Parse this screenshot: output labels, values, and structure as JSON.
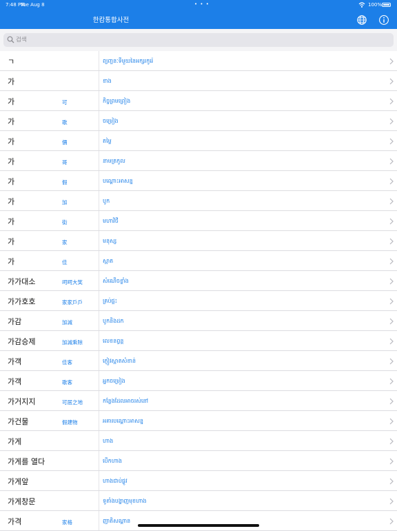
{
  "status": {
    "time": "7:48 PM",
    "date": "Tue Aug 8",
    "dots": "• • •",
    "battery": "100%"
  },
  "nav": {
    "title": "한캄통합사전",
    "icons": [
      "globe-icon",
      "info-icon"
    ]
  },
  "search": {
    "placeholder": "검색",
    "value": ""
  },
  "entries": [
    {
      "word": "ㄱ",
      "hanja": "",
      "meaning": "ព្យញ្ជនៈទីមួយនៃអក្សរកូរ៉េ"
    },
    {
      "word": "가",
      "hanja": "",
      "meaning": "ខាង"
    },
    {
      "word": "가",
      "hanja": "可",
      "meaning": "កិច្ចព្រមព្រៀង"
    },
    {
      "word": "가",
      "hanja": "歌",
      "meaning": "ចម្រៀង"
    },
    {
      "word": "가",
      "hanja": "價",
      "meaning": "តម្លៃ"
    },
    {
      "word": "가",
      "hanja": "哥",
      "meaning": "នាមត្រកូល"
    },
    {
      "word": "가",
      "hanja": "假",
      "meaning": "បណ្ដោះអាសន្ន"
    },
    {
      "word": "가",
      "hanja": "加",
      "meaning": "បូក"
    },
    {
      "word": "가",
      "hanja": "街",
      "meaning": "មហាវិថី"
    },
    {
      "word": "가",
      "hanja": "家",
      "meaning": "មនុស្ស"
    },
    {
      "word": "가",
      "hanja": "佳",
      "meaning": "ស្អាត"
    },
    {
      "word": "가가대소",
      "hanja": "呵呵大笑",
      "meaning": "សំណើចខ្លាំង"
    },
    {
      "word": "가가호호",
      "hanja": "家家戶戶",
      "meaning": "គ្រប់ផ្ទះ"
    },
    {
      "word": "가감",
      "hanja": "加減",
      "meaning": "បូកនិងដក"
    },
    {
      "word": "가감승제",
      "hanja": "加減乘除",
      "meaning": "លេខនព្វន្ត"
    },
    {
      "word": "가객",
      "hanja": "佳客",
      "meaning": "ភ្ញៀវស្អាតសំខាន់"
    },
    {
      "word": "가객",
      "hanja": "歌客",
      "meaning": "អ្នកចម្រៀង"
    },
    {
      "word": "가거지지",
      "hanja": "可居之地",
      "meaning": "កន្លែងដែលអាចរស់នៅ"
    },
    {
      "word": "가건물",
      "hanja": "假建物",
      "meaning": "អគារបណ្ដោះអាសន្ន"
    },
    {
      "word": "가게",
      "hanja": "",
      "meaning": "ហាង"
    },
    {
      "word": "가게를 열다",
      "hanja": "",
      "meaning": "បើកហាង"
    },
    {
      "word": "가게앞",
      "hanja": "",
      "meaning": "ហាងជាប់ផ្លូវ"
    },
    {
      "word": "가게창문",
      "hanja": "",
      "meaning": "ទូតាំងបង្ហាញមុខហាង"
    },
    {
      "word": "가격",
      "hanja": "家格",
      "meaning": "ញាតិសណ្ដាន"
    }
  ],
  "colors": {
    "brand": "#1c7fe8",
    "separator": "#dcdce0",
    "search_bg": "#e5e5ea"
  }
}
